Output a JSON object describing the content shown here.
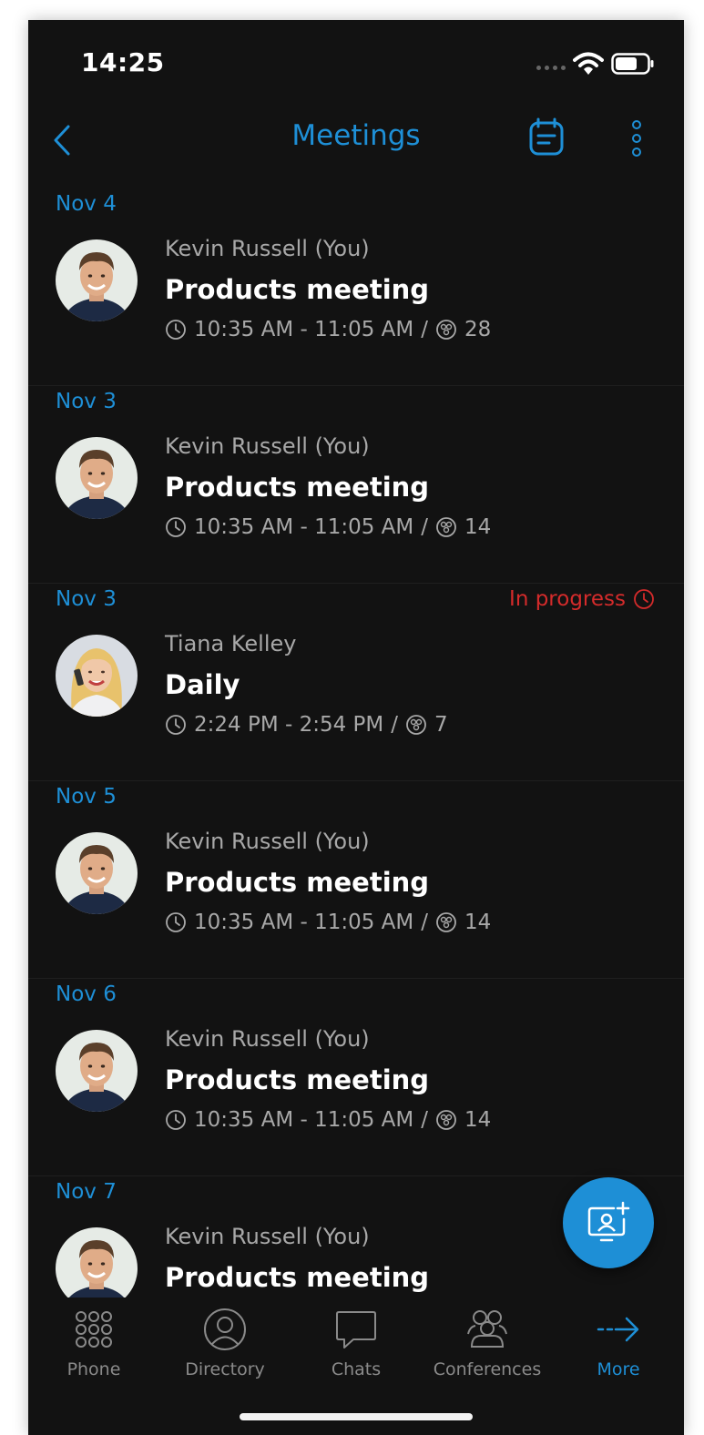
{
  "status_bar": {
    "time": "14:25"
  },
  "header": {
    "title": "Meetings"
  },
  "meetings": [
    {
      "date": "Nov 4",
      "organizer": "Kevin Russell (You)",
      "title": "Products meeting",
      "time": "10:35 AM - 11:05 AM",
      "separator": "/",
      "participants": "28",
      "status": "",
      "avatar": "male"
    },
    {
      "date": "Nov 3",
      "organizer": "Kevin Russell (You)",
      "title": "Products meeting",
      "time": "10:35 AM - 11:05 AM",
      "separator": "/",
      "participants": "14",
      "status": "",
      "avatar": "male"
    },
    {
      "date": "Nov 3",
      "organizer": "Tiana Kelley",
      "title": "Daily",
      "time": "2:24 PM - 2:54 PM",
      "separator": "/",
      "participants": "7",
      "status": "In progress",
      "avatar": "female"
    },
    {
      "date": "Nov 5",
      "organizer": "Kevin Russell (You)",
      "title": "Products meeting",
      "time": "10:35 AM - 11:05 AM",
      "separator": "/",
      "participants": "14",
      "status": "",
      "avatar": "male"
    },
    {
      "date": "Nov 6",
      "organizer": "Kevin Russell (You)",
      "title": "Products meeting",
      "time": "10:35 AM - 11:05 AM",
      "separator": "/",
      "participants": "14",
      "status": "",
      "avatar": "male"
    },
    {
      "date": "Nov 7",
      "organizer": "Kevin Russell (You)",
      "title": "Products meeting",
      "time": "",
      "separator": "",
      "participants": "",
      "status": "",
      "avatar": "male"
    }
  ],
  "tabs": [
    {
      "label": "Phone",
      "icon": "dialpad-icon",
      "active": false
    },
    {
      "label": "Directory",
      "icon": "contact-icon",
      "active": false
    },
    {
      "label": "Chats",
      "icon": "chat-bubble-icon",
      "active": false
    },
    {
      "label": "Conferences",
      "icon": "group-icon",
      "active": false
    },
    {
      "label": "More",
      "icon": "arrow-right-icon",
      "active": true
    }
  ],
  "colors": {
    "accent": "#1e8fd6",
    "status_in_progress": "#d42b2b",
    "background": "#121212",
    "secondary_text": "#a8a8a8"
  }
}
